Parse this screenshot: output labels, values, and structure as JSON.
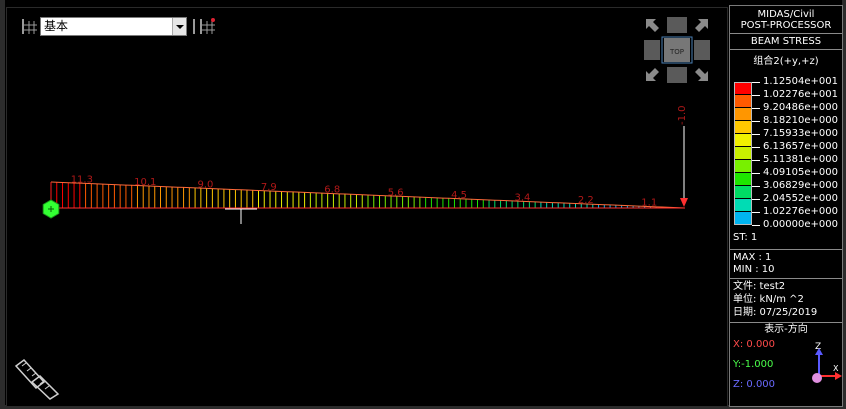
{
  "toolbar": {
    "combo_value": "基本",
    "left_icon": "stress-component-icon",
    "right_icon": "stress-component-alt-icon"
  },
  "view_cube": {
    "label": "TOP"
  },
  "beam": {
    "labels": [
      "11.3",
      "10.1",
      "9.0",
      "7.9",
      "6.8",
      "5.6",
      "4.5",
      "3.4",
      "2.2",
      "1.1"
    ],
    "load_label": "-1.0",
    "end_value": 0
  },
  "legend": {
    "title_line1": "MIDAS/Civil",
    "title_line2": "POST-PROCESSOR",
    "result_type": "BEAM STRESS",
    "load_case": "组合2(+y,+z)",
    "values": [
      "1.12504e+001",
      "1.02276e+001",
      "9.20486e+000",
      "8.18210e+000",
      "7.15933e+000",
      "6.13657e+000",
      "5.11381e+000",
      "4.09105e+000",
      "3.06829e+000",
      "2.04552e+000",
      "1.02276e+000",
      "0.00000e+000"
    ],
    "colors": [
      "#ff0000",
      "#ff5a00",
      "#ff9600",
      "#ffc800",
      "#f0f000",
      "#c8f000",
      "#78f000",
      "#1ee600",
      "#00dc64",
      "#00dcb4",
      "#00b4f0",
      "#0078ff"
    ],
    "st": "ST: 1",
    "max": "MAX : 1",
    "min": "MIN : 10",
    "file": "文件: test2",
    "unit": "单位: kN/m ^2",
    "date": "日期: 07/25/2019",
    "direction_title": "表示-方向",
    "x": "X: 0.000",
    "y": "Y:-1.000",
    "z": "Z: 0.000",
    "x_color": "#ff4a4a",
    "y_color": "#4aff4a",
    "z_color": "#6a6aff",
    "axis_z_label": "Z",
    "axis_x_label": "X"
  }
}
